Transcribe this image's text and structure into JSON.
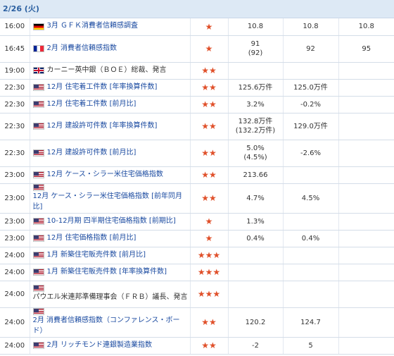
{
  "date_header": "2/26 (火)",
  "colors": {
    "star": "#e0502a",
    "link": "#1a4aa0",
    "header_bg": "#dde9f5",
    "header_text": "#2a5fa0"
  },
  "icons": {
    "star": "★"
  },
  "rows": [
    {
      "time": "16:00",
      "flag": "de",
      "event": "3月 ＧＦＫ消費者信頼感調査",
      "stars": "★",
      "prev": "10.8",
      "prev_rev": "",
      "forecast": "10.8",
      "actual": "10.8",
      "h": 24
    },
    {
      "time": "16:45",
      "flag": "fr",
      "event": "2月 消費者信頼感指数",
      "stars": "★",
      "prev": "91",
      "prev_rev": "(92)",
      "forecast": "92",
      "actual": "95",
      "h": 38
    },
    {
      "time": "19:00",
      "flag": "gb",
      "event": "カーニー英中銀（ＢＯＥ）総裁、発言",
      "stars": "★★",
      "prev": "",
      "prev_rev": "",
      "forecast": "",
      "actual": "",
      "h": 24
    },
    {
      "time": "22:30",
      "flag": "us",
      "event": "12月 住宅着工件数 [年率換算件数]",
      "stars": "★★",
      "prev": "125.6万件",
      "prev_rev": "",
      "forecast": "125.0万件",
      "actual": "",
      "h": 24
    },
    {
      "time": "22:30",
      "flag": "us",
      "event": "12月 住宅着工件数 [前月比]",
      "stars": "★★",
      "prev": "3.2%",
      "prev_rev": "",
      "forecast": "-0.2%",
      "actual": "",
      "h": 24
    },
    {
      "time": "22:30",
      "flag": "us",
      "event": "12月 建設許可件数 [年率換算件数]",
      "stars": "★★",
      "prev": "132.8万件",
      "prev_rev": "(132.2万件)",
      "forecast": "129.0万件",
      "actual": "",
      "h": 38
    },
    {
      "time": "22:30",
      "flag": "us",
      "event": "12月 建設許可件数 [前月比]",
      "stars": "★★",
      "prev": "5.0%",
      "prev_rev": "(4.5%)",
      "forecast": "-2.6%",
      "actual": "",
      "h": 38
    },
    {
      "time": "23:00",
      "flag": "us",
      "event": "12月 ケース・シラー米住宅価格指数",
      "stars": "★★",
      "prev": "213.66",
      "prev_rev": "",
      "forecast": "",
      "actual": "",
      "h": 24
    },
    {
      "time": "23:00",
      "flag": "us",
      "event": "12月 ケース・シラー米住宅価格指数 [前年同月比]",
      "stars": "★★",
      "prev": "4.7%",
      "prev_rev": "",
      "forecast": "4.5%",
      "actual": "",
      "h": 38
    },
    {
      "time": "23:00",
      "flag": "us",
      "event": "10-12月期 四半期住宅価格指数 [前期比]",
      "stars": "★",
      "prev": "1.3%",
      "prev_rev": "",
      "forecast": "",
      "actual": "",
      "h": 24
    },
    {
      "time": "23:00",
      "flag": "us",
      "event": "12月 住宅価格指数 [前月比]",
      "stars": "★",
      "prev": "0.4%",
      "prev_rev": "",
      "forecast": "0.4%",
      "actual": "",
      "h": 24
    },
    {
      "time": "24:00",
      "flag": "us",
      "event": "1月 新築住宅販売件数 [前月比]",
      "stars": "★★★",
      "prev": "",
      "prev_rev": "",
      "forecast": "",
      "actual": "",
      "h": 24
    },
    {
      "time": "24:00",
      "flag": "us",
      "event": "1月 新築住宅販売件数 [年率換算件数]",
      "stars": "★★★",
      "prev": "",
      "prev_rev": "",
      "forecast": "",
      "actual": "",
      "h": 24
    },
    {
      "time": "24:00",
      "flag": "us",
      "event": "パウエル米連邦準備理事会（ＦＲＢ）議長、発言",
      "stars": "★★★",
      "prev": "",
      "prev_rev": "",
      "forecast": "",
      "actual": "",
      "h": 38
    },
    {
      "time": "24:00",
      "flag": "us",
      "event": "2月 消費者信頼感指数（コンファレンス・ボード）",
      "stars": "★★",
      "prev": "120.2",
      "prev_rev": "",
      "forecast": "124.7",
      "actual": "",
      "h": 38
    },
    {
      "time": "24:00",
      "flag": "us",
      "event": "2月 リッチモンド連銀製造業指数",
      "stars": "★★",
      "prev": "-2",
      "prev_rev": "",
      "forecast": "5",
      "actual": "",
      "h": 24
    }
  ]
}
